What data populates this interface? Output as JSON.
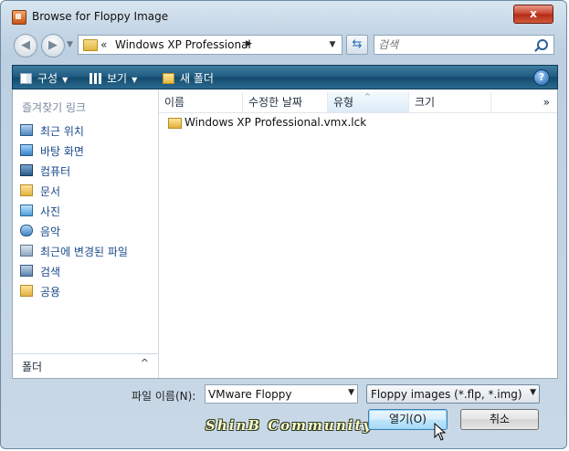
{
  "window": {
    "title": "Browse for Floppy Image",
    "close_label": "x"
  },
  "navigation": {
    "back_icon": "back-arrow-icon",
    "forward_icon": "forward-arrow-icon",
    "address_prefix": "«",
    "address_path": "Windows XP Professional",
    "search_placeholder": "검색"
  },
  "toolbar": {
    "organize_label": "구성",
    "views_label": "보기",
    "new_folder_label": "새 폴더",
    "help_label": "?"
  },
  "sidebar": {
    "header": "즐겨찾기 링크",
    "items": [
      {
        "label": "최근 위치",
        "icon": "recent-places-icon"
      },
      {
        "label": "바탕 화면",
        "icon": "desktop-icon"
      },
      {
        "label": "컴퓨터",
        "icon": "computer-icon"
      },
      {
        "label": "문서",
        "icon": "documents-folder-icon"
      },
      {
        "label": "사진",
        "icon": "pictures-icon"
      },
      {
        "label": "음악",
        "icon": "music-icon"
      },
      {
        "label": "최근에 변경된 파일",
        "icon": "recently-changed-icon"
      },
      {
        "label": "검색",
        "icon": "searches-icon"
      },
      {
        "label": "공용",
        "icon": "public-folder-icon"
      }
    ],
    "folders_label": "폴더"
  },
  "file_list": {
    "columns": [
      "이름",
      "수정한 날짜",
      "유형",
      "크기"
    ],
    "more": "»",
    "sorted_column": "유형",
    "files": [
      {
        "name": "Windows XP Professional.vmx.lck",
        "icon": "folder-icon"
      }
    ]
  },
  "footer": {
    "filename_label": "파일 이름(N):",
    "filename_value": "VMware Floppy",
    "filter_value": "Floppy images (*.flp, *.img)",
    "open_label": "열기(O)",
    "cancel_label": "취소",
    "watermark": "ShinB Community"
  }
}
